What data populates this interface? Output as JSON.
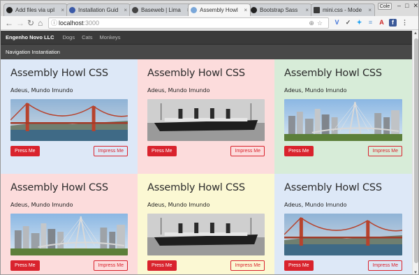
{
  "browser": {
    "tabs": [
      {
        "label": "Add files via upl",
        "icon": "github-icon"
      },
      {
        "label": "Installation Guid",
        "icon": "globe-icon"
      },
      {
        "label": "Baseweb | Lima",
        "icon": "biohazard-icon"
      },
      {
        "label": "Assembly Howl",
        "icon": "globe-icon"
      },
      {
        "label": "Bootstrap Sass",
        "icon": "github-icon"
      },
      {
        "label": "mini.css - Mode",
        "icon": "minicss-icon"
      }
    ],
    "user_chip": "Cole",
    "url_host": "localhost",
    "url_port": ":3000"
  },
  "navbar": {
    "brand": "Engenho Novo LLC",
    "links": [
      "Dogs",
      "Cats",
      "Monkeys"
    ]
  },
  "subnav": {
    "label": "Navigation Instantiation"
  },
  "cards": [
    {
      "title": "Assembly Howl CSS",
      "text": "Adeus, Mundo Imundo",
      "photo": "golden-gate-bridge",
      "primary": "Press Me",
      "secondary": "Impress Me",
      "bg": "#dde8f7"
    },
    {
      "title": "Assembly Howl CSS",
      "text": "Adeus, Mundo Imundo",
      "photo": "titanic-ship",
      "primary": "Press Me",
      "secondary": "Impress Me",
      "bg": "#fcdcdc"
    },
    {
      "title": "Assembly Howl CSS",
      "text": "Adeus, Mundo Imundo",
      "photo": "city-skyline-bridge",
      "primary": "Press Me",
      "secondary": "Impress Me",
      "bg": "#d7ecd8"
    },
    {
      "title": "Assembly Howl CSS",
      "text": "Adeus, Mundo Imundo",
      "photo": "city-skyline-bridge",
      "primary": "Press Me",
      "secondary": "Impress Me",
      "bg": "#fcdcdc"
    },
    {
      "title": "Assembly Howl CSS",
      "text": "Adeus, Mundo Imundo",
      "photo": "titanic-ship",
      "primary": "Press Me",
      "secondary": "Impress Me",
      "bg": "#fbf8d3"
    },
    {
      "title": "Assembly Howl CSS",
      "text": "Adeus, Mundo Imundo",
      "photo": "golden-gate-bridge",
      "primary": "Press Me",
      "secondary": "Impress Me",
      "bg": "#dde8f7"
    }
  ],
  "colors": {
    "primary_button": "#d9232d",
    "navbar": "#3a3a3a",
    "subbar": "#484848"
  }
}
